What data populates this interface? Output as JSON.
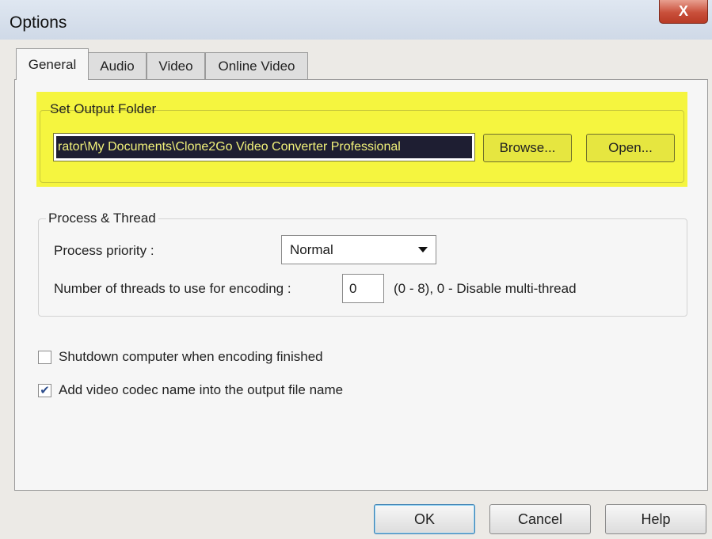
{
  "window": {
    "title": "Options",
    "close_glyph": "X"
  },
  "tabs": [
    {
      "label": "General",
      "active": true
    },
    {
      "label": "Audio",
      "active": false
    },
    {
      "label": "Video",
      "active": false
    },
    {
      "label": "Online Video",
      "active": false
    }
  ],
  "output_folder": {
    "group_label": "Set Output Folder",
    "path_value": "rator\\My Documents\\Clone2Go Video Converter Professional",
    "browse_label": "Browse...",
    "open_label": "Open...",
    "highlight_color": "#f5f53f"
  },
  "process": {
    "group_label": "Process & Thread",
    "priority_label": "Process priority :",
    "priority_value": "Normal",
    "threads_label": "Number of threads to use for encoding :",
    "threads_value": "0",
    "threads_hint": "(0 - 8), 0 - Disable multi-thread"
  },
  "options": {
    "shutdown_label": "Shutdown computer when encoding finished",
    "shutdown_checked": false,
    "codec_name_label": "Add video codec name into the output file name",
    "codec_name_checked": true,
    "check_glyph": "✔"
  },
  "buttons": {
    "ok": "OK",
    "cancel": "Cancel",
    "help": "Help"
  }
}
